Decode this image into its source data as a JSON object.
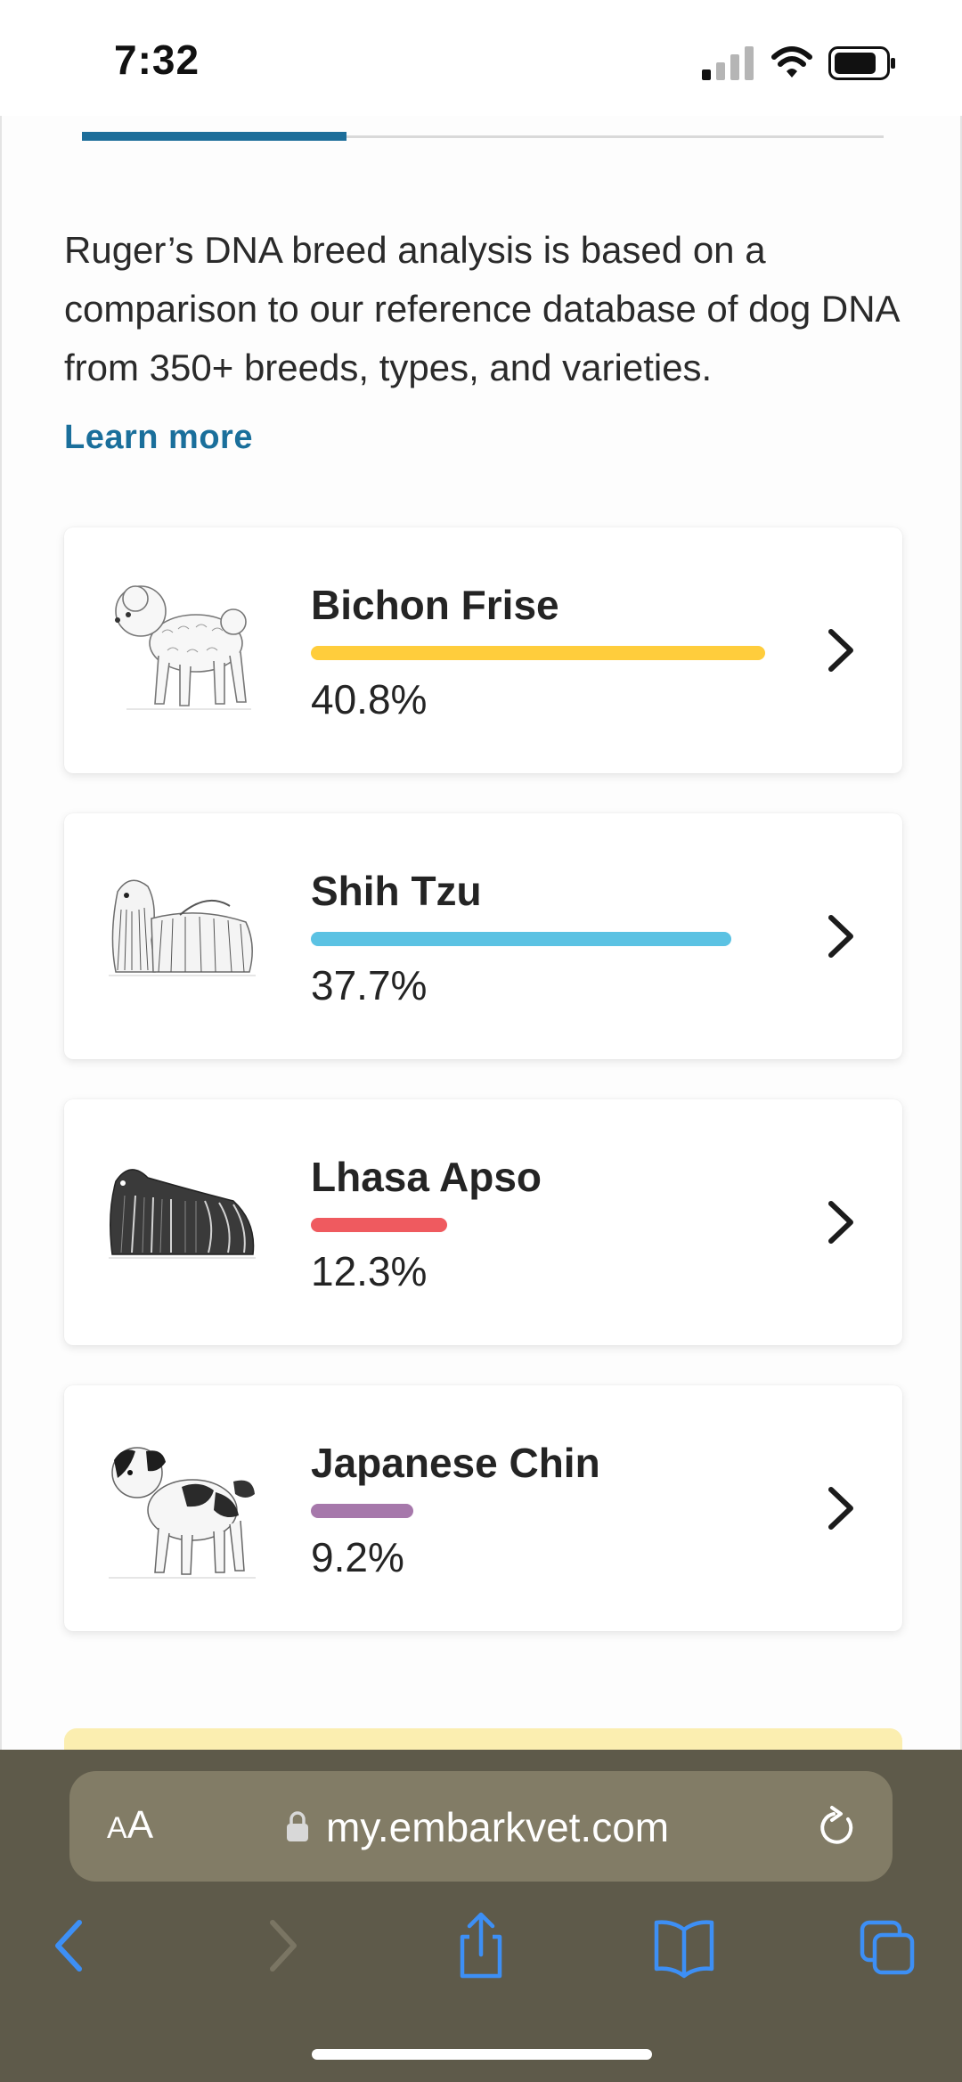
{
  "status_bar": {
    "time": "7:32"
  },
  "page": {
    "intro_text": "Ruger’s DNA breed analysis is based on a comparison to our reference database of dog DNA from 350+ breeds, types, and varieties.",
    "learn_more_label": "Learn more",
    "tab_progress": 0.33
  },
  "breeds": [
    {
      "name": "Bichon Frise",
      "percent_label": "40.8%",
      "bar_fraction": 1.0,
      "color": "#ffcd3c",
      "icon": "bichon-frise-illustration"
    },
    {
      "name": "Shih Tzu",
      "percent_label": "37.7%",
      "bar_fraction": 0.925,
      "color": "#5bc2e3",
      "icon": "shih-tzu-illustration"
    },
    {
      "name": "Lhasa Apso",
      "percent_label": "12.3%",
      "bar_fraction": 0.3,
      "color": "#ef5a5f",
      "icon": "lhasa-apso-illustration"
    },
    {
      "name": "Japanese Chin",
      "percent_label": "9.2%",
      "bar_fraction": 0.225,
      "color": "#a678ab",
      "icon": "japanese-chin-illustration"
    }
  ],
  "browser": {
    "aa_label_small": "A",
    "aa_label_large": "A",
    "url": "my.embarkvet.com",
    "accent_color": "#3d8ff5"
  }
}
